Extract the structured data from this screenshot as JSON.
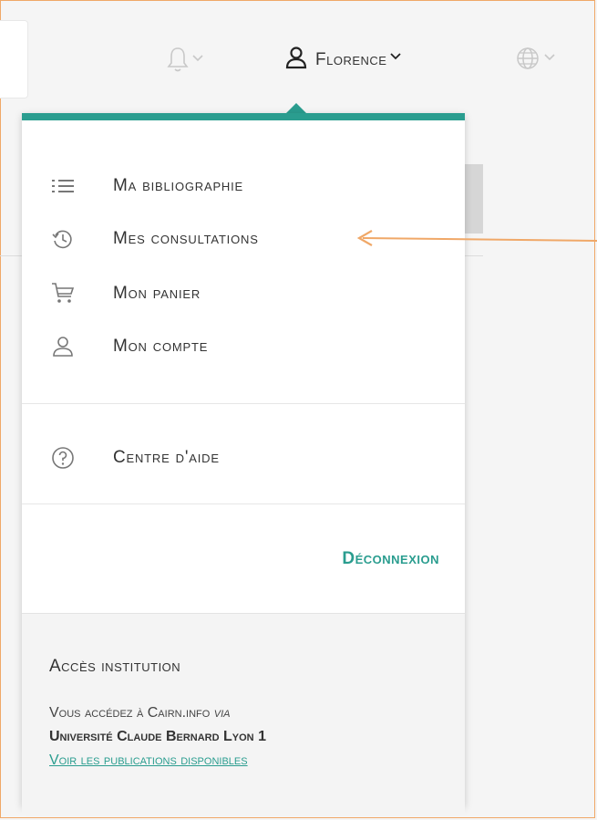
{
  "header": {
    "user_name": "Florence",
    "icons": [
      "bell-icon",
      "user-icon",
      "globe-icon",
      "chevron-down-icon"
    ]
  },
  "menu": {
    "items": [
      {
        "label": "Ma bibliographie",
        "icon": "list-icon"
      },
      {
        "label": "Mes consultations",
        "icon": "history-icon"
      },
      {
        "label": "Mon panier",
        "icon": "cart-icon"
      },
      {
        "label": "Mon compte",
        "icon": "user-icon"
      }
    ],
    "help": {
      "label": "Centre d'aide",
      "icon": "help-icon"
    },
    "logout_label": "Déconnexion"
  },
  "institution": {
    "title": "Accès institution",
    "text_prefix": "Vous accédez à Cairn.info ",
    "text_via": "via",
    "name": "Université Claude Bernard Lyon 1",
    "link_label": "Voir les publications disponibles"
  },
  "colors": {
    "accent": "#2a9d8f",
    "annotation": "#f0a868"
  }
}
